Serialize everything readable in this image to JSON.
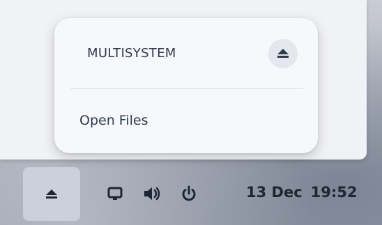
{
  "popover": {
    "device_name": "MULTISYSTEM",
    "menu_items": [
      {
        "label": "Open Files"
      }
    ]
  },
  "panel": {
    "tray_icons": [
      "eject-icon",
      "display-icon",
      "volume-icon",
      "power-icon"
    ],
    "clock": {
      "date": "13 Dec",
      "time": "19:52"
    }
  },
  "colors": {
    "popover_bg": "#f7f8fb",
    "text": "#2f3a4d",
    "panel_text": "#1f2633"
  }
}
